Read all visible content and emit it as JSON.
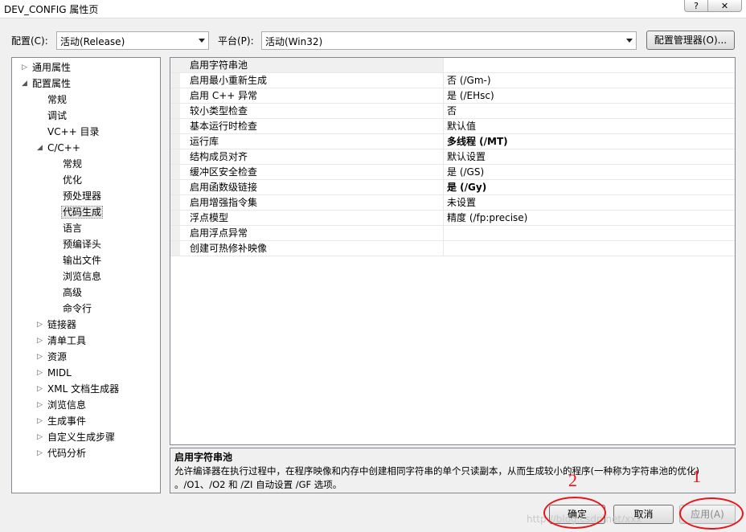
{
  "window": {
    "title": "DEV_CONFIG 属性页",
    "help_label": "?",
    "close_label": "✕"
  },
  "header": {
    "config_label": "配置(C):",
    "config_value": "活动(Release)",
    "platform_label": "平台(P):",
    "platform_value": "活动(Win32)",
    "config_manager_label": "配置管理器(O)..."
  },
  "tree": [
    {
      "label": "通用属性",
      "level": 0,
      "toggle": "▷"
    },
    {
      "label": "配置属性",
      "level": 0,
      "toggle": "◢"
    },
    {
      "label": "常规",
      "level": 1,
      "toggle": ""
    },
    {
      "label": "调试",
      "level": 1,
      "toggle": ""
    },
    {
      "label": "VC++ 目录",
      "level": 1,
      "toggle": ""
    },
    {
      "label": "C/C++",
      "level": 1,
      "toggle": "◢"
    },
    {
      "label": "常规",
      "level": 2,
      "toggle": ""
    },
    {
      "label": "优化",
      "level": 2,
      "toggle": ""
    },
    {
      "label": "预处理器",
      "level": 2,
      "toggle": ""
    },
    {
      "label": "代码生成",
      "level": 2,
      "toggle": "",
      "selected": true
    },
    {
      "label": "语言",
      "level": 2,
      "toggle": ""
    },
    {
      "label": "预编译头",
      "level": 2,
      "toggle": ""
    },
    {
      "label": "输出文件",
      "level": 2,
      "toggle": ""
    },
    {
      "label": "浏览信息",
      "level": 2,
      "toggle": ""
    },
    {
      "label": "高级",
      "level": 2,
      "toggle": ""
    },
    {
      "label": "命令行",
      "level": 2,
      "toggle": ""
    },
    {
      "label": "链接器",
      "level": 1,
      "toggle": "▷"
    },
    {
      "label": "清单工具",
      "level": 1,
      "toggle": "▷"
    },
    {
      "label": "资源",
      "level": 1,
      "toggle": "▷"
    },
    {
      "label": "MIDL",
      "level": 1,
      "toggle": "▷"
    },
    {
      "label": "XML 文档生成器",
      "level": 1,
      "toggle": "▷"
    },
    {
      "label": "浏览信息",
      "level": 1,
      "toggle": "▷"
    },
    {
      "label": "生成事件",
      "level": 1,
      "toggle": "▷"
    },
    {
      "label": "自定义生成步骤",
      "level": 1,
      "toggle": "▷"
    },
    {
      "label": "代码分析",
      "level": 1,
      "toggle": "▷"
    }
  ],
  "properties": [
    {
      "name": "启用字符串池",
      "value": "",
      "selected": true
    },
    {
      "name": "启用最小重新生成",
      "value": "否 (/Gm-)"
    },
    {
      "name": "启用 C++ 异常",
      "value": "是 (/EHsc)"
    },
    {
      "name": "较小类型检查",
      "value": "否"
    },
    {
      "name": "基本运行时检查",
      "value": "默认值"
    },
    {
      "name": "运行库",
      "value": "多线程 (/MT)",
      "bold": true
    },
    {
      "name": "结构成员对齐",
      "value": "默认设置"
    },
    {
      "name": "缓冲区安全检查",
      "value": "是 (/GS)"
    },
    {
      "name": "启用函数级链接",
      "value": "是 (/Gy)",
      "bold": true
    },
    {
      "name": "启用增强指令集",
      "value": "未设置"
    },
    {
      "name": "浮点模型",
      "value": "精度 (/fp:precise)"
    },
    {
      "name": "启用浮点异常",
      "value": ""
    },
    {
      "name": "创建可热修补映像",
      "value": ""
    }
  ],
  "description": {
    "title": "启用字符串池",
    "line1": "允许编译器在执行过程中，在程序映像和内存中创建相同字符串的单个只读副本，从而生成较小的程序(一种称为字符串池的优化)",
    "line2": "。/O1、/O2 和 /ZI 自动设置 /GF 选项。"
  },
  "footer": {
    "ok_label": "确定",
    "cancel_label": "取消",
    "apply_label": "应用(A)"
  },
  "annotations": {
    "mark1": "1",
    "mark2": "2"
  },
  "watermark": "http://blog.csdn.net/xxx",
  "colors": {
    "annotation_red": "#e8141a"
  }
}
